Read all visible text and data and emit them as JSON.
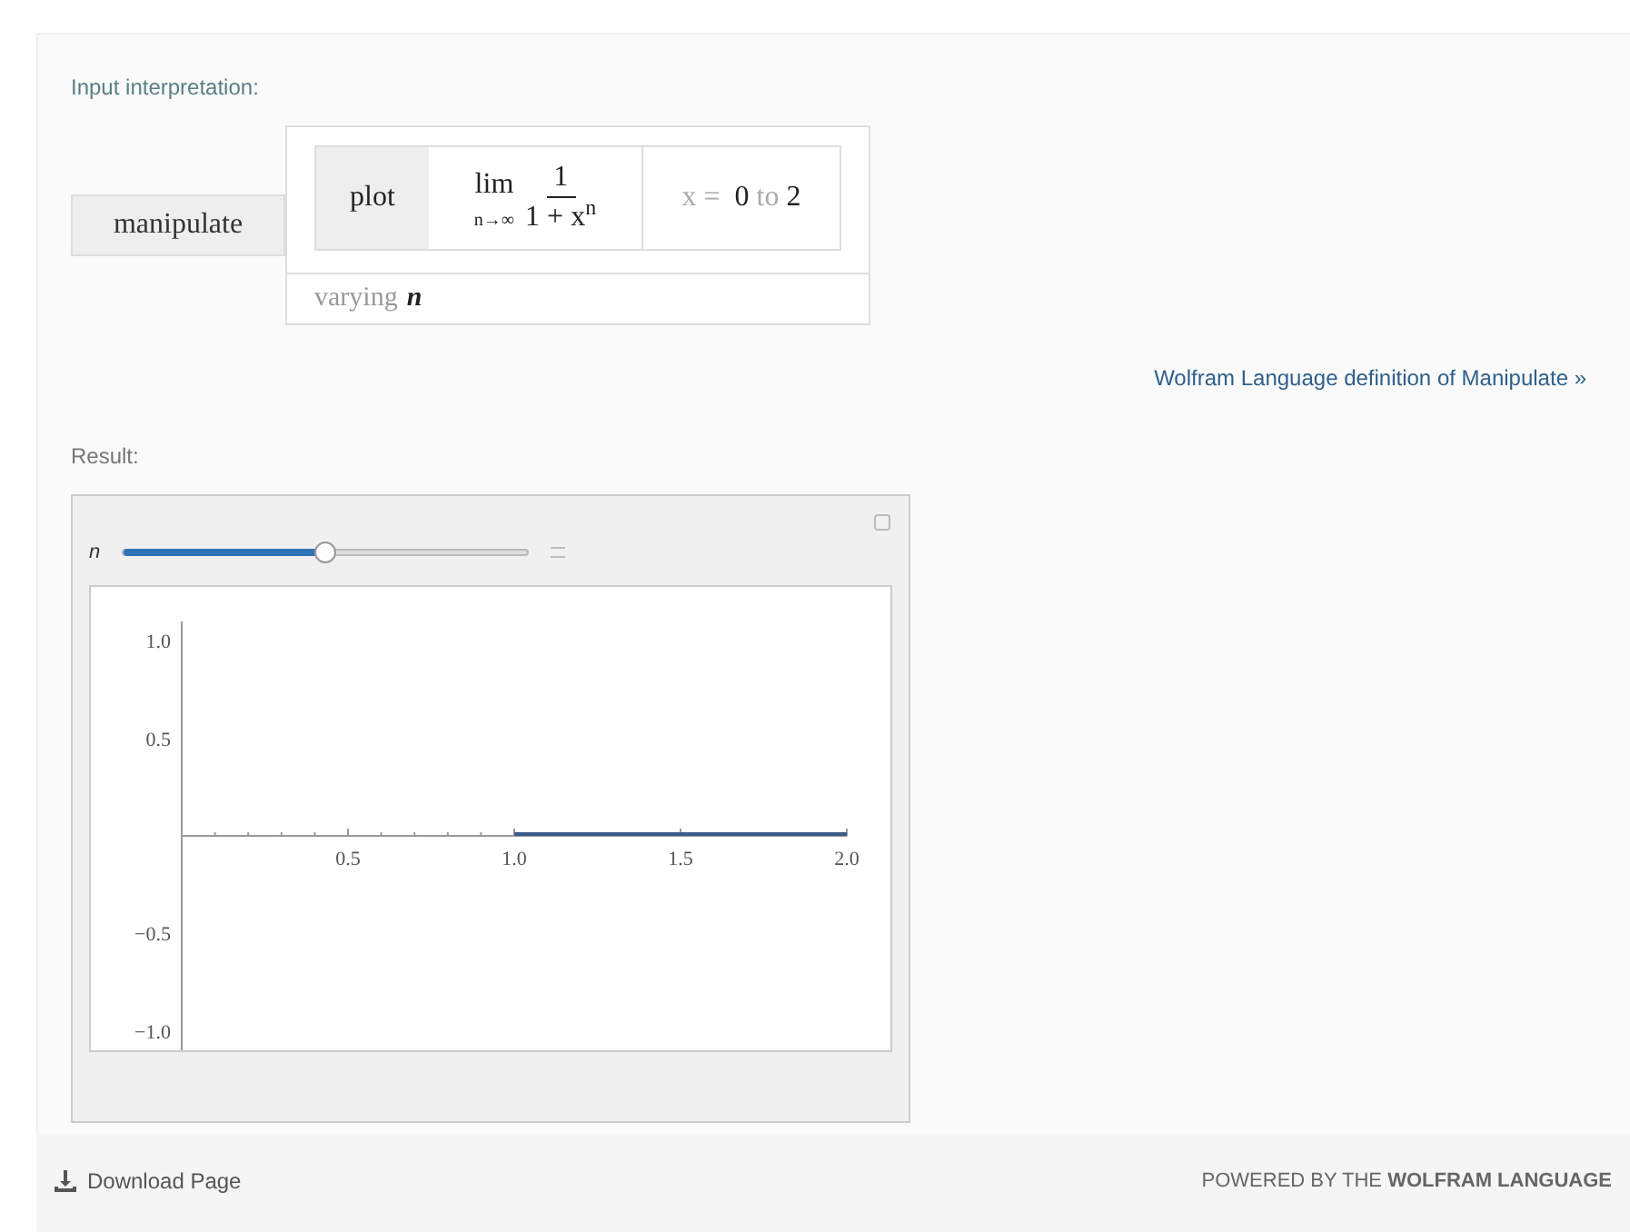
{
  "input_pod": {
    "title": "Input interpretation:",
    "function_label": "manipulate",
    "plot_label": "plot",
    "formula": {
      "operator": "lim",
      "subscript": "n→∞",
      "numerator": "1",
      "denominator": "1 + x$^{n}$"
    },
    "range": [
      {
        "text": "x = ",
        "dark": false
      },
      {
        "text": "0",
        "dark": true
      },
      {
        "text": "to",
        "dark": false
      },
      {
        "text": "2",
        "dark": true
      }
    ],
    "varying": {
      "word": "varying",
      "variable": "n"
    },
    "link": "Wolfram Language definition of Manipulate »"
  },
  "result_pod": {
    "title": "Result:",
    "slider": {
      "label": "n",
      "level": 0.5
    },
    "chart_data": {
      "type": "line",
      "x": [
        1,
        2
      ],
      "series": [
        {
          "color": "#3b5b8c",
          "values": [
            0,
            0
          ]
        }
      ],
      "xlim": [
        0,
        2
      ],
      "ylim": [
        -1.1,
        1.1
      ],
      "xticks": [
        {
          "value": 0.5,
          "label": "0.5"
        },
        {
          "value": 1,
          "label": "1.0"
        },
        {
          "value": 1.5,
          "label": "1.5"
        },
        {
          "value": 2,
          "label": "2.0"
        }
      ],
      "yticks": [
        {
          "value": -1,
          "label": "−1.0"
        },
        {
          "value": -0.5,
          "label": "−0.5"
        },
        {
          "value": 0.5,
          "label": "0.5"
        },
        {
          "value": 1,
          "label": "1.0"
        }
      ]
    }
  },
  "footer": {
    "download": "Download Page",
    "powered": "POWERED BY THE **WOLFRAM LANGUAGE**"
  }
}
